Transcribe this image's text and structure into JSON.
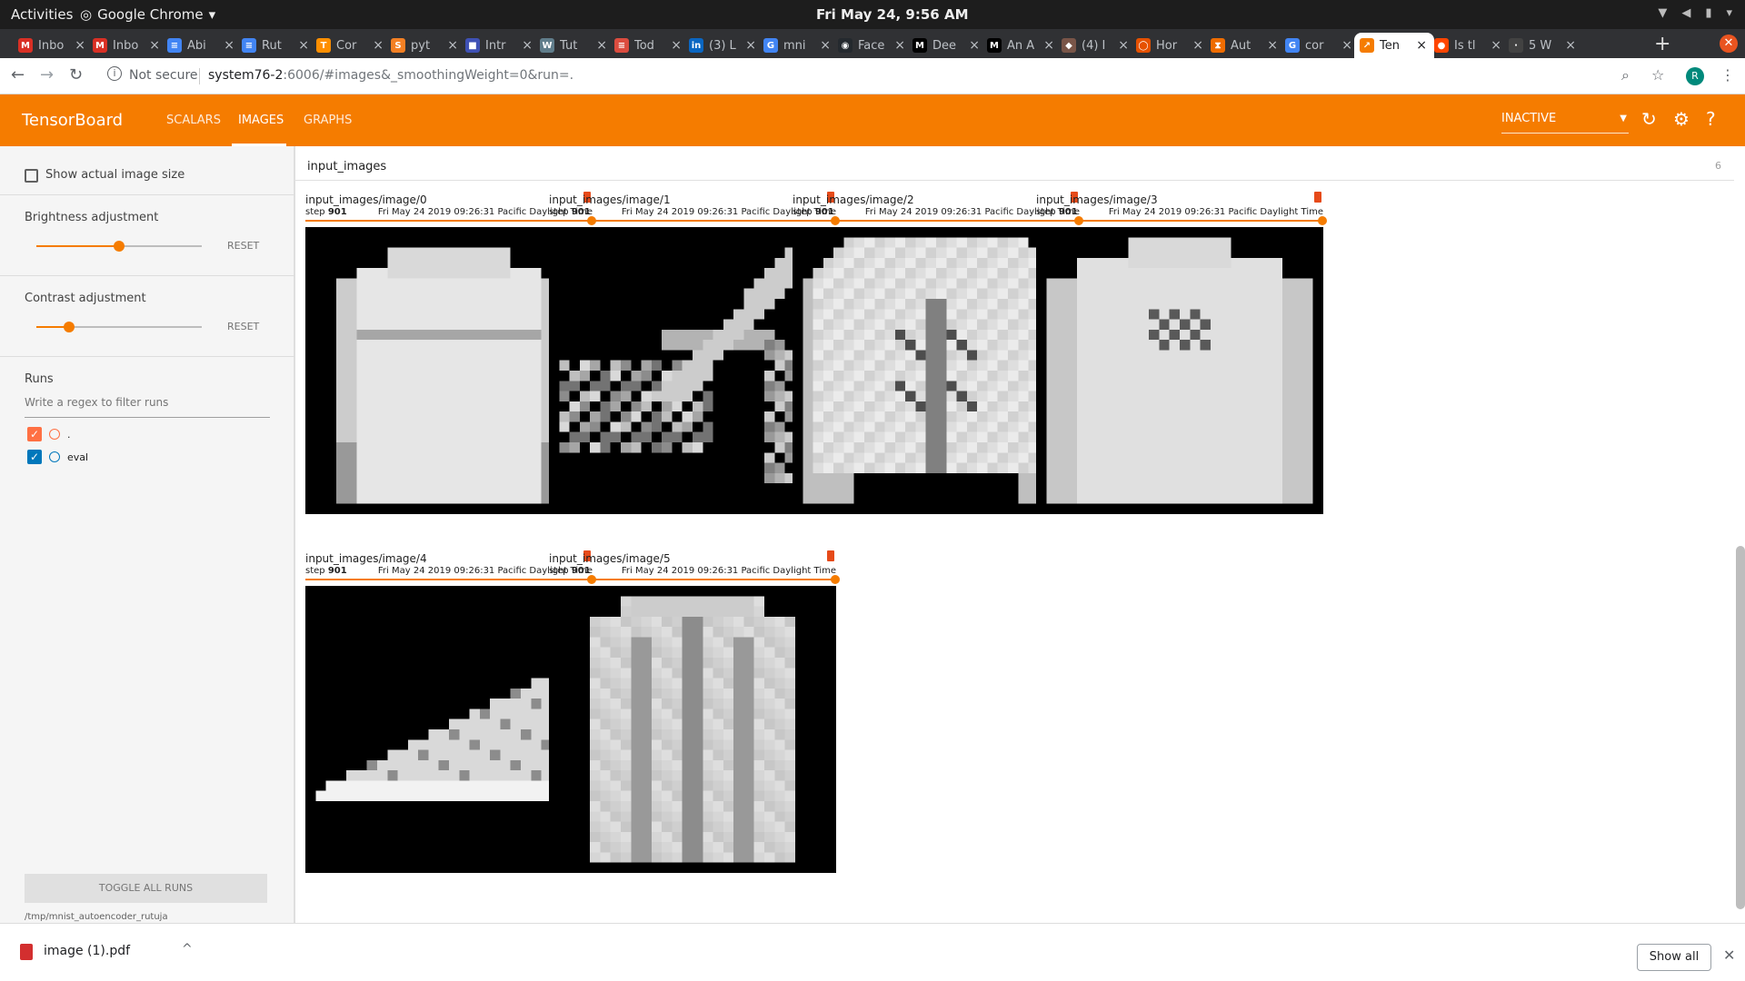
{
  "system": {
    "activities": "Activities",
    "app_name": "Google Chrome",
    "clock": "Fri May 24,  9:56 AM"
  },
  "tabs": [
    {
      "label": "Inbo",
      "icon": "gmail-icon",
      "color": "#d93025",
      "glyph": "M"
    },
    {
      "label": "Inbo",
      "icon": "gmail-icon",
      "color": "#d93025",
      "glyph": "M"
    },
    {
      "label": "Abi",
      "icon": "docs-icon",
      "color": "#4285f4",
      "glyph": "≡"
    },
    {
      "label": "Rut",
      "icon": "docs-icon",
      "color": "#4285f4",
      "glyph": "≡"
    },
    {
      "label": "Cor",
      "icon": "tensorflow-icon",
      "color": "#ff8f00",
      "glyph": "T"
    },
    {
      "label": "pyt",
      "icon": "stack-icon",
      "color": "#f48024",
      "glyph": "S"
    },
    {
      "label": "Intr",
      "icon": "site-icon",
      "color": "#3f51b5",
      "glyph": "■"
    },
    {
      "label": "Tut",
      "icon": "site-icon",
      "color": "#607d8b",
      "glyph": "W"
    },
    {
      "label": "Tod",
      "icon": "todoist-icon",
      "color": "#db4c3f",
      "glyph": "≡"
    },
    {
      "label": "(3) L",
      "icon": "linkedin-icon",
      "color": "#0a66c2",
      "glyph": "in"
    },
    {
      "label": "mni",
      "icon": "google-icon",
      "color": "#4285f4",
      "glyph": "G"
    },
    {
      "label": "Face",
      "icon": "github-icon",
      "color": "#24292e",
      "glyph": "◉"
    },
    {
      "label": "Dee",
      "icon": "medium-icon",
      "color": "#000000",
      "glyph": "M"
    },
    {
      "label": "An A",
      "icon": "medium-icon",
      "color": "#000000",
      "glyph": "M"
    },
    {
      "label": "(4) I",
      "icon": "site-icon",
      "color": "#795548",
      "glyph": "◆"
    },
    {
      "label": "Hor",
      "icon": "site-icon",
      "color": "#e65100",
      "glyph": "◯"
    },
    {
      "label": "Aut",
      "icon": "site-icon",
      "color": "#ef6c00",
      "glyph": "⧗"
    },
    {
      "label": "cor",
      "icon": "google-icon",
      "color": "#4285f4",
      "glyph": "G"
    },
    {
      "label": "Ten",
      "icon": "tensorboard-icon",
      "color": "#f57c00",
      "glyph": "↗"
    },
    {
      "label": "Is tl",
      "icon": "reddit-icon",
      "color": "#ff4500",
      "glyph": "●"
    },
    {
      "label": "5 W",
      "icon": "site-icon",
      "color": "#424242",
      "glyph": "·"
    }
  ],
  "omnibox": {
    "security": "Not secure",
    "url_host": "system76-2",
    "url_rest": ":6006/#images&_smoothingWeight=0&run=."
  },
  "tensorboard": {
    "title": "TensorBoard",
    "nav": [
      "SCALARS",
      "IMAGES",
      "GRAPHS"
    ],
    "active_nav": "IMAGES",
    "reload_state": "INACTIVE"
  },
  "sidebar": {
    "show_actual_size": "Show actual image size",
    "brightness_label": "Brightness adjustment",
    "brightness_value": 0.5,
    "contrast_label": "Contrast adjustment",
    "contrast_value": 0.2,
    "reset": "RESET",
    "runs_label": "Runs",
    "runs_filter_placeholder": "Write a regex to filter runs",
    "runs": [
      {
        "name": ".",
        "checked": true,
        "color": "#ff7043"
      },
      {
        "name": "eval",
        "checked": true,
        "color": "#0077bb"
      }
    ],
    "toggle_all": "TOGGLE ALL RUNS",
    "logdir": "/tmp/mnist_autoencoder_rutuja"
  },
  "category": {
    "name": "input_images",
    "count": "6"
  },
  "cards": [
    {
      "name": "input_images/image/0",
      "step_label": "step",
      "step": "901",
      "time": "Fri May 24 2019 09:26:31 Pacific Daylight Time",
      "subject": "shirt"
    },
    {
      "name": "input_images/image/1",
      "step_label": "step",
      "step": "901",
      "time": "Fri May 24 2019 09:26:31 Pacific Daylight Time",
      "subject": "sandal"
    },
    {
      "name": "input_images/image/2",
      "step_label": "step",
      "step": "901",
      "time": "Fri May 24 2019 09:26:31 Pacific Daylight Time",
      "subject": "jacket"
    },
    {
      "name": "input_images/image/3",
      "step_label": "step",
      "step": "901",
      "time": "Fri May 24 2019 09:26:31 Pacific Daylight Time",
      "subject": "pullover"
    },
    {
      "name": "input_images/image/4",
      "step_label": "step",
      "step": "901",
      "time": "Fri May 24 2019 09:26:31 Pacific Daylight Time",
      "subject": "sneaker"
    },
    {
      "name": "input_images/image/5",
      "step_label": "step",
      "step": "901",
      "time": "Fri May 24 2019 09:26:31 Pacific Daylight Time",
      "subject": "coat"
    }
  ],
  "download": {
    "filename": "image (1).pdf",
    "show_all": "Show all"
  }
}
